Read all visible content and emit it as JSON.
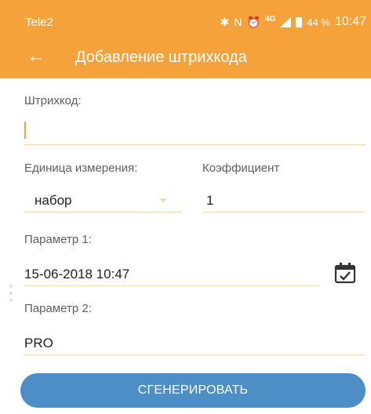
{
  "status_bar": {
    "carrier": "Tele2",
    "network": "4G",
    "battery": "44 %",
    "time": "10:47"
  },
  "toolbar": {
    "back_icon": "arrow-left-icon",
    "title": "Добавление штрихкода"
  },
  "form": {
    "barcode_label": "Штрихкод:",
    "barcode_value": "",
    "unit_label": "Единица измерения:",
    "unit_value": "набор",
    "coef_label": "Коэффициент",
    "coef_value": "1",
    "param1_label": "Параметр 1:",
    "param1_value": "15-06-2018 10:47",
    "param2_label": "Параметр 2:",
    "param2_value": "PRO",
    "generate_label": "СГЕНЕРИРОВАТЬ"
  },
  "colors": {
    "accent": "#f6a23a",
    "button": "#4d8ec6",
    "underline": "#f3d7b1"
  }
}
